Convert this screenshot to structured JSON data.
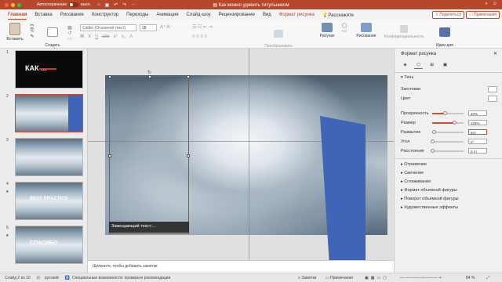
{
  "titlebar": {
    "autosave_label": "Автосохранение",
    "autosave_state": "выкл.",
    "document_title": "Как можно удивить титульником"
  },
  "tabs": [
    "Главная",
    "Вставка",
    "Рисование",
    "Конструктор",
    "Переходы",
    "Анимация",
    "Слайд-шоу",
    "Рецензирование",
    "Вид",
    "Формат рисунка",
    "Расскажите"
  ],
  "tabs_active": "Главная",
  "share_label": "Поделиться",
  "comments_label": "Примечания",
  "ribbon": {
    "paste": "Вставить",
    "new_slide": "Создать\nслайд",
    "font_name": "Calibri (Основной текст)",
    "font_size": "18",
    "smartart": "Преобразовать\nв SmartArt",
    "picture": "Рисунок",
    "drawing": "Рисование",
    "confidentiality": "Конфиденциальность",
    "design_ideas": "Идеи для\nоформления"
  },
  "thumbnails": [
    {
      "num": "1",
      "title": "КАК ..."
    },
    {
      "num": "2",
      "selected": true
    },
    {
      "num": "3"
    },
    {
      "num": "4",
      "star": true,
      "title": "BEST PRACTICS"
    },
    {
      "num": "5",
      "star": true,
      "title": "СПАСИБО"
    }
  ],
  "slide": {
    "caption": "Замещающий текст:..."
  },
  "notes_placeholder": "Щелкните, чтобы добавить заметки",
  "format_pane": {
    "title": "Формат рисунка",
    "section": "Тень",
    "rows": [
      {
        "label": "Заготовки"
      },
      {
        "label": "Цвет"
      },
      {
        "label": "Прозрачность",
        "value": "40%",
        "fraction": 0.4
      },
      {
        "label": "Размер",
        "value": "102%",
        "fraction": 0.7
      },
      {
        "label": "Размытие",
        "value": "6пт",
        "fraction": 0.06
      },
      {
        "label": "Угол",
        "value": "0°",
        "fraction": 0.0
      },
      {
        "label": "Расстояние",
        "value": "0 пт",
        "fraction": 0.0
      }
    ],
    "collapsed_sections": [
      "Отражение",
      "Свечение",
      "Сглаживание",
      "Формат объемной фигуры",
      "Поворот объемной фигуры",
      "Художественные эффекты"
    ]
  },
  "status": {
    "slide_info": "Слайд 2 из 10",
    "language": "русский",
    "accessibility": "Специальные возможности: проверьте рекомендации",
    "notes": "Заметки",
    "comments": "Примечания",
    "zoom": "84 %"
  },
  "colors": {
    "accent": "#b7472a",
    "selection": "#d04f30",
    "shape_blue": "#4065b8"
  }
}
